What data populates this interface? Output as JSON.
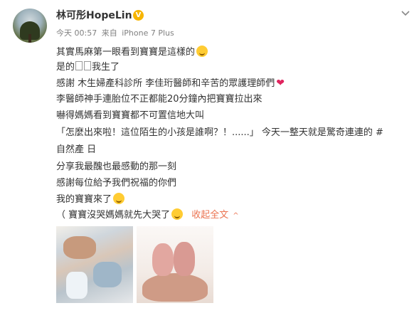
{
  "user": {
    "name": "林可彤HopeLin",
    "verified_mark": "V"
  },
  "meta": {
    "time": "今天 00:57",
    "source_prefix": "来自",
    "source": "iPhone 7 Plus"
  },
  "post": {
    "line1": "其實馬麻第一眼看到寶寶是這樣的",
    "line2_a": "是的",
    "line2_b": "我生了",
    "line3": "感謝 木生婦產科診所 李佳珩醫師和辛苦的眾護理師們",
    "line4": "李醫師神手連胎位不正都能20分鐘內把寶寶拉出來",
    "line5": "嚇得媽媽看到寶寶都不可置信地大叫",
    "line6": "「怎麼出來啦！這位陌生的小孩是誰啊？！......」 今天一整天就是驚奇連連的 #",
    "line7": "自然產 日",
    "line8": "分享我最醜也最感動的那一刻",
    "line9": "感謝每位給予我們祝福的你們",
    "line10": "我的寶寶來了",
    "line11": "（ 寶寶沒哭媽媽就先大哭了",
    "collapse_label": "收起全文",
    "collapse_arrow": "^"
  },
  "colors": {
    "accent_link": "#eb7350",
    "verified": "#f7b500",
    "heart": "#e0245e"
  },
  "icons": [
    "verified-icon",
    "chevron-down-icon",
    "laughing-emoji-icon",
    "heart-icon",
    "wink-emoji-icon",
    "chevron-up-icon"
  ]
}
